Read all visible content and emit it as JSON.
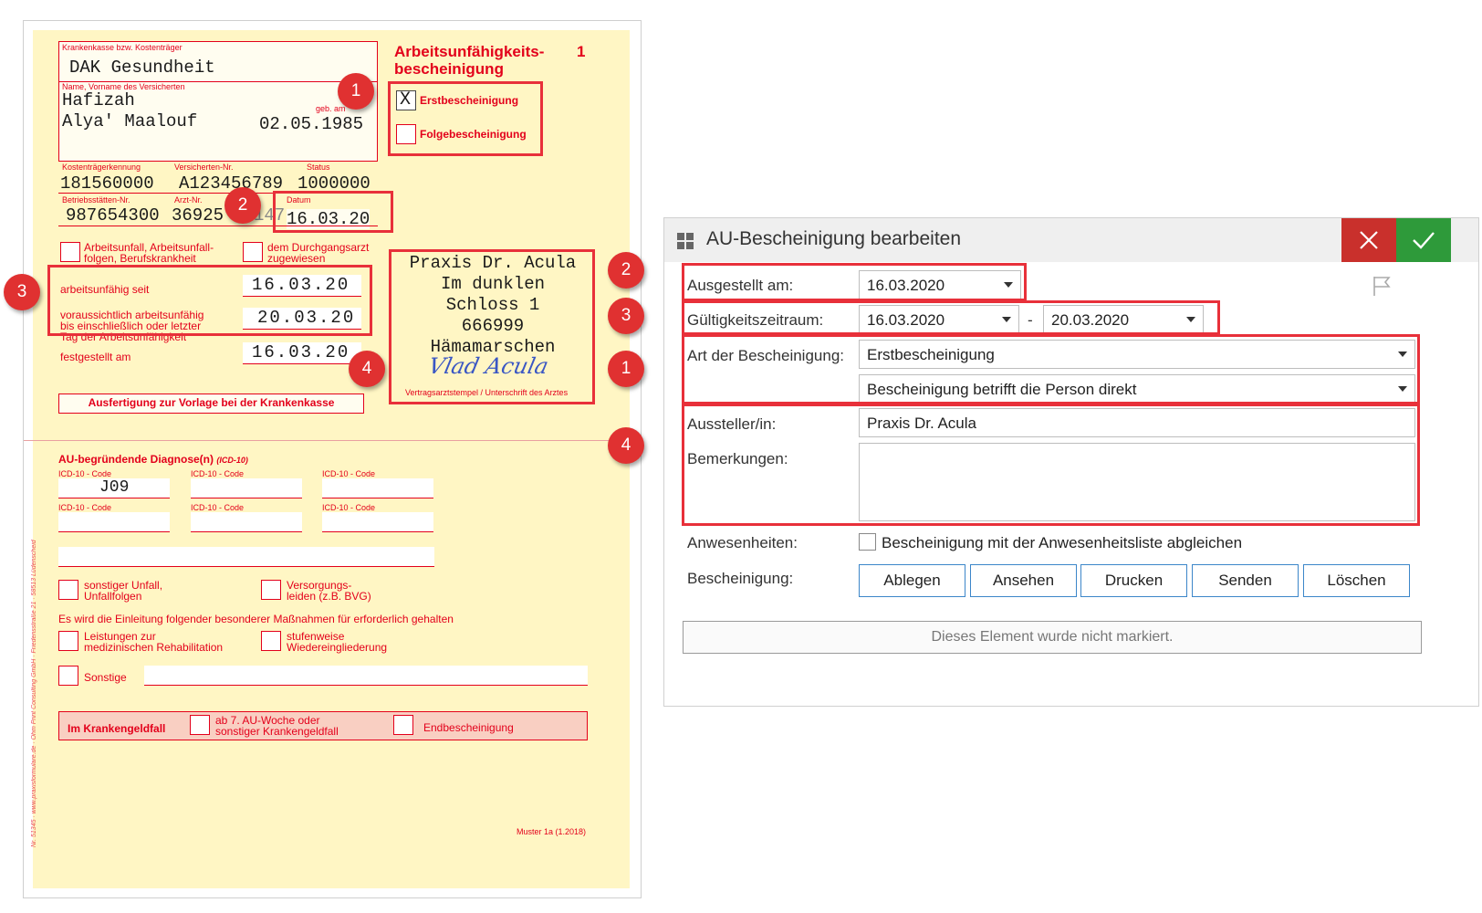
{
  "form": {
    "title_line1": "Arbeitsunfähigkeits-",
    "title_line2": "bescheinigung",
    "copy_no": "1",
    "insurer_label": "Krankenkasse bzw. Kostenträger",
    "insurer_value": "DAK Gesundheit",
    "name_label": "Name, Vorname des Versicherten",
    "name_line1": "Hafizah",
    "name_line2": "Alya' Maalouf",
    "dob_label": "geb. am",
    "dob_value": "02.05.1985",
    "cost_id_label": "Kostenträgerkennung",
    "cost_id_value": "181560000",
    "insured_no_label": "Versicherten-Nr.",
    "insured_no_value": "A123456789",
    "status_label": "Status",
    "status_value": "1000000",
    "site_no_label": "Betriebsstätten-Nr.",
    "site_no_value": "987654300",
    "doctor_no_label": "Arzt-Nr.",
    "doctor_no_value": "36925",
    "doctor_no_extra": "147",
    "date_label": "Datum",
    "date_value": "16.03.20",
    "first_cert_mark": "X",
    "first_cert_label": "Erstbescheinigung",
    "follow_cert_label": "Folgebescheinigung",
    "accident_label_1": "Arbeitsunfall, Arbeitsunfall-",
    "accident_label_2": "folgen, Berufskrankheit",
    "transit_label_1": "dem Durchgangsarzt",
    "transit_label_2": "zugewiesen",
    "unfit_since_label": "arbeitsunfähig seit",
    "unfit_since_value": "16.03.20",
    "unfit_until_label_1": "voraussichtlich arbeitsunfähig",
    "unfit_until_label_2": "bis einschließlich oder letzter",
    "unfit_until_label_3": "Tag der Arbeitsunfähigkeit",
    "unfit_until_value": "20.03.20",
    "determined_label": "festgestellt am",
    "determined_value": "16.03.20",
    "stamp_lines": [
      "Praxis Dr. Acula",
      "Im dunklen",
      "Schloss 1",
      "666999",
      "Hämamarschen"
    ],
    "signature": "Vlad Acula",
    "stamp_caption": "Vertragsarztstempel / Unterschrift des Arztes",
    "copy_note": "Ausfertigung zur Vorlage bei der Krankenkasse",
    "diag_heading": "AU-begründende Diagnose(n)",
    "diag_heading_suffix": "(ICD-10)",
    "icd_label": "ICD-10 - Code",
    "icd_value_1": "J09",
    "other_accident_1": "sonstiger Unfall,",
    "other_accident_2": "Unfallfolgen",
    "supply_1": "Versorgungs-",
    "supply_2": "leiden (z.B. BVG)",
    "measures_text": "Es wird die Einleitung folgender besonderer Maßnahmen für erforderlich gehalten",
    "rehab_1": "Leistungen zur",
    "rehab_2": "medizinischen Rehabilitation",
    "reintegration_1": "stufenweise",
    "reintegration_2": "Wiedereingliederung",
    "other_label": "Sonstige",
    "sick_pay_label": "Im Krankengeldfall",
    "week7_1": "ab 7. AU-Woche oder",
    "week7_2": "sonstiger Krankengeldfall",
    "final_cert": "Endbescheinigung",
    "form_version": "Muster 1a (1.2018)",
    "side_print": "Nr. 51345 · www.praxisformulare.de · Ohm Print Consulting GmbH · Friedensstraße 21 · 58513 Lüdenscheid"
  },
  "callouts": [
    "1",
    "2",
    "3",
    "4"
  ],
  "dialog": {
    "title": "AU-Bescheinigung bearbeiten",
    "issued_label": "Ausgestellt am:",
    "issued_value": "16.03.2020",
    "validity_label": "Gültigkeitszeitraum:",
    "validity_from": "16.03.2020",
    "validity_sep": "-",
    "validity_to": "20.03.2020",
    "type_label": "Art der Bescheinigung:",
    "type_value": "Erstbescheinigung",
    "subject_value": "Bescheinigung betrifft die Person direkt",
    "issuer_label": "Aussteller/in:",
    "issuer_value": "Praxis Dr. Acula",
    "remarks_label": "Bemerkungen:",
    "remarks_value": "",
    "attendance_label": "Anwesenheiten:",
    "attendance_checkbox_label": "Bescheinigung mit der Anwesenheitsliste abgleichen",
    "certificate_label": "Bescheinigung:",
    "buttons": [
      "Ablegen",
      "Ansehen",
      "Drucken",
      "Senden",
      "Löschen"
    ],
    "status_text": "Dieses Element wurde nicht markiert.",
    "colors": {
      "cancel": "#c9302c",
      "confirm": "#2e9a3a",
      "accent": "#3c86c9",
      "highlight": "#e8303a"
    }
  }
}
